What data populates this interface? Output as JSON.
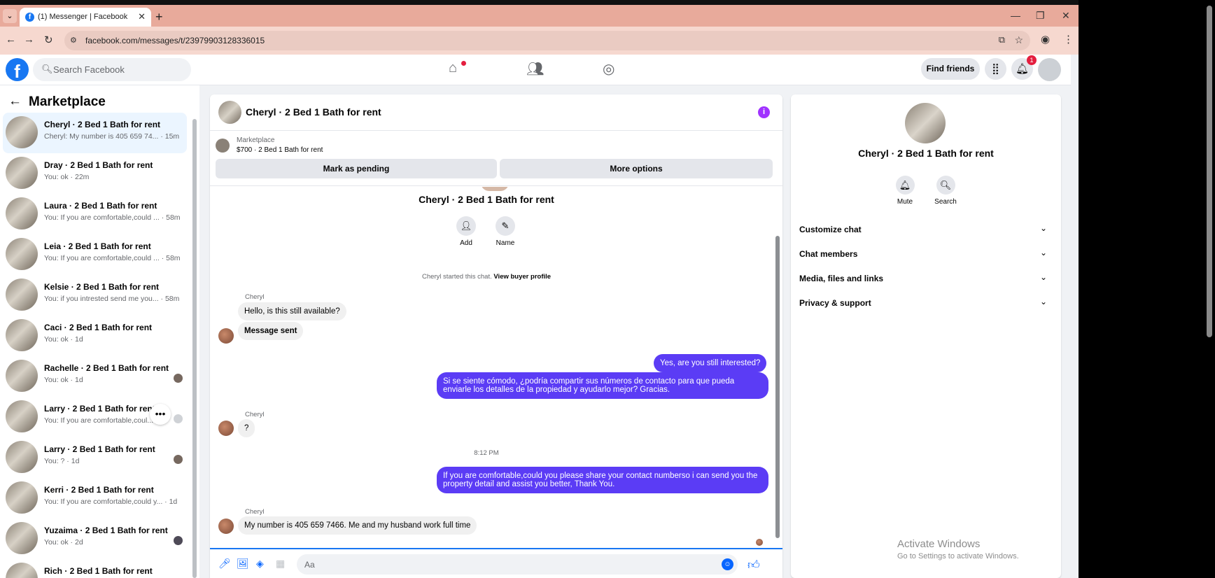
{
  "browser": {
    "tab_title": "(1) Messenger | Facebook",
    "url": "facebook.com/messages/t/23979903128336015"
  },
  "header": {
    "search_placeholder": "Search Facebook",
    "find_friends": "Find friends",
    "notification_count": "1",
    "brand_color": "#1877f2"
  },
  "sidebar": {
    "title": "Marketplace",
    "conversations": [
      {
        "name": "Cheryl · 2 Bed 1 Bath for rent",
        "preview": "Cheryl: My number is 405 659 74... · 15m",
        "active": true
      },
      {
        "name": "Dray · 2 Bed 1 Bath for rent",
        "preview": "You: ok · 22m"
      },
      {
        "name": "Laura · 2 Bed 1 Bath for rent",
        "preview": "You: If you are comfortable,could ... · 58m"
      },
      {
        "name": "Leia · 2 Bed 1 Bath for rent",
        "preview": "You: If you are comfortable,could ... · 58m"
      },
      {
        "name": "Kelsie · 2 Bed 1 Bath for rent",
        "preview": "You: if you intrested send me you... · 58m"
      },
      {
        "name": "Caci · 2 Bed 1 Bath for rent",
        "preview": "You: ok · 1d"
      },
      {
        "name": "Rachelle · 2 Bed 1 Bath for rent",
        "preview": "You: ok · 1d"
      },
      {
        "name": "Larry · 2 Bed 1 Bath for rent",
        "preview": "You: If you are comfortable,coul..."
      },
      {
        "name": "Larry · 2 Bed 1 Bath for rent",
        "preview": "You: ? · 1d"
      },
      {
        "name": "Kerri · 2 Bed 1 Bath for rent",
        "preview": "You: If you are comfortable,could y... · 1d"
      },
      {
        "name": "Yuzaima · 2 Bed 1 Bath for rent",
        "preview": "You: ok · 2d"
      },
      {
        "name": "Rich · 2 Bed 1 Bath for rent",
        "preview": ""
      }
    ]
  },
  "chat": {
    "title": "Cheryl · 2 Bed 1 Bath for rent",
    "marketplace_label": "Marketplace",
    "listing": "$700 · 2 Bed 1 Bath for rent",
    "mark_pending": "Mark as pending",
    "more_options": "More options",
    "profile_name": "Cheryl · 2 Bed 1 Bath for rent",
    "add_label": "Add",
    "name_label": "Name",
    "started_text": "Cheryl started this chat.",
    "view_buyer": "View buyer profile",
    "sender": "Cheryl",
    "messages": {
      "m1": "Hello, is this still available?",
      "m2": "Message sent",
      "m3": "Yes, are you still interested?",
      "m4": "Si se siente cómodo, ¿podría compartir sus números de contacto para que pueda enviarle los detalles de la propiedad y ayudarlo mejor? Gracias.",
      "m5": "?",
      "time": "8:12 PM",
      "m6": "If you are comfortable,could you please share your contact numberso i can send you the property detail and assist you better, Thank You.",
      "m7": "My number is 405 659 7466. Me and my husband work full time"
    },
    "composer_placeholder": "Aa",
    "outgoing_color": "#5b3cf5"
  },
  "info": {
    "name": "Cheryl · 2 Bed 1 Bath for rent",
    "mute": "Mute",
    "search": "Search",
    "sections": [
      "Customize chat",
      "Chat members",
      "Media, files and links",
      "Privacy & support"
    ]
  },
  "watermark": {
    "line1": "Activate Windows",
    "line2": "Go to Settings to activate Windows."
  }
}
